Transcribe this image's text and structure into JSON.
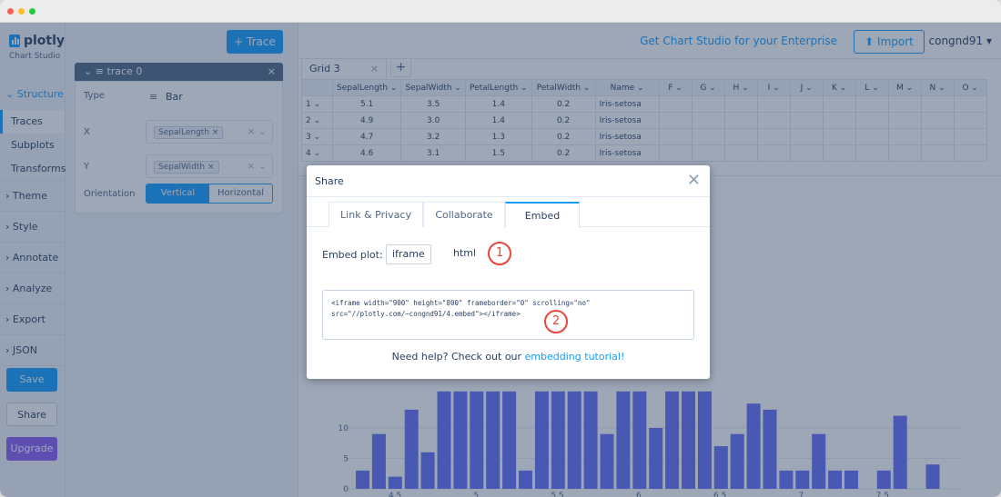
{
  "window": {
    "dots": [
      "#ff5f57",
      "#febc2e",
      "#28c840"
    ]
  },
  "brand": {
    "name": "plotly",
    "sub": "Chart Studio"
  },
  "nav": {
    "structure": "Structure",
    "sub_items": [
      "Traces",
      "Subplots",
      "Transforms"
    ],
    "groups": [
      "Theme",
      "Style",
      "Annotate",
      "Analyze",
      "Export",
      "JSON"
    ],
    "save": "Save",
    "share": "Share",
    "upgrade": "Upgrade"
  },
  "panel": {
    "add_trace": "+ Trace",
    "trace_name": "trace 0",
    "type_label": "Type",
    "type_value": "Bar",
    "x_label": "X",
    "x_value": "SepalLength",
    "y_label": "Y",
    "y_value": "SepalWidth",
    "orientation_label": "Orientation",
    "orientation_options": [
      "Vertical",
      "Horizontal"
    ]
  },
  "topbar": {
    "enterprise": "Get Chart Studio for your Enterprise",
    "import": "Import",
    "user": "congnd91"
  },
  "grid": {
    "tab": "Grid 3",
    "columns": [
      "SepalLength",
      "SepalWidth",
      "PetalLength",
      "PetalWidth",
      "Name",
      "F",
      "G",
      "H",
      "I",
      "J",
      "K",
      "L",
      "M",
      "N",
      "O"
    ],
    "rows": [
      [
        "1",
        "5.1",
        "3.5",
        "1.4",
        "0.2",
        "Iris-setosa"
      ],
      [
        "2",
        "4.9",
        "3.0",
        "1.4",
        "0.2",
        "Iris-setosa"
      ],
      [
        "3",
        "4.7",
        "3.2",
        "1.3",
        "0.2",
        "Iris-setosa"
      ],
      [
        "4",
        "4.6",
        "3.1",
        "1.5",
        "0.2",
        "Iris-setosa"
      ]
    ]
  },
  "chart_data": {
    "type": "bar",
    "x_ticks": [
      "4.5",
      "5",
      "5.5",
      "6",
      "6.5",
      "7",
      "7.5"
    ],
    "y_ticks": [
      "0",
      "5",
      "10"
    ],
    "values": [
      3,
      9,
      2,
      13,
      6,
      16,
      16,
      16,
      16,
      16,
      3,
      16,
      16,
      16,
      16,
      9,
      16,
      16,
      10,
      16,
      16,
      16,
      7,
      9,
      14,
      13,
      3,
      3,
      9,
      3,
      3,
      0,
      3,
      12,
      0,
      4
    ]
  },
  "share_modal": {
    "title": "Share",
    "tabs": [
      "Link & Privacy",
      "Collaborate",
      "Embed"
    ],
    "embed_label": "Embed plot:",
    "options": [
      "iframe",
      "html"
    ],
    "code": "<iframe width=\"900\" height=\"800\" frameborder=\"0\" scrolling=\"no\"\nsrc=\"//plotly.com/~congnd91/4.embed\"></iframe>",
    "help_prefix": "Need help? Check out our ",
    "help_link": "embedding tutorial!",
    "callouts": [
      "1",
      "2"
    ]
  }
}
